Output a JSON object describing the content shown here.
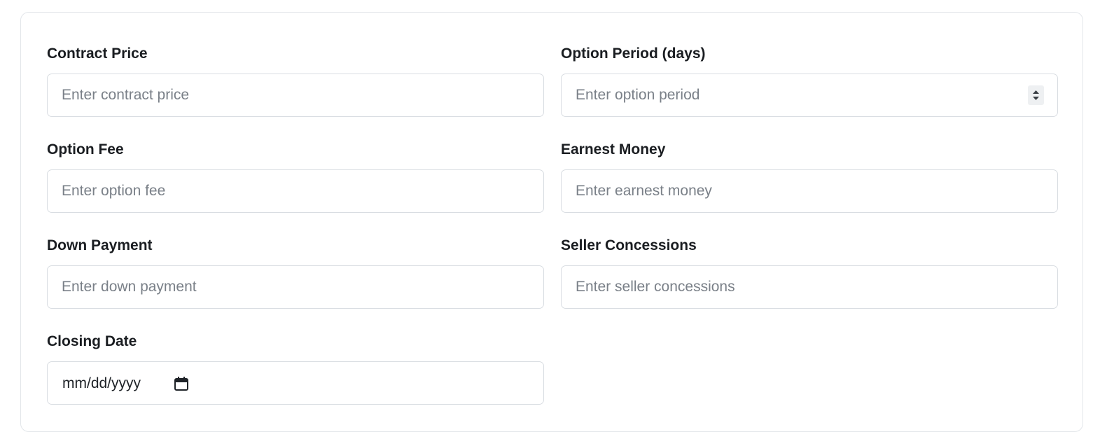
{
  "form": {
    "contract_price": {
      "label": "Contract Price",
      "placeholder": "Enter contract price"
    },
    "option_period": {
      "label": "Option Period (days)",
      "placeholder": "Enter option period"
    },
    "option_fee": {
      "label": "Option Fee",
      "placeholder": "Enter option fee"
    },
    "earnest_money": {
      "label": "Earnest Money",
      "placeholder": "Enter earnest money"
    },
    "down_payment": {
      "label": "Down Payment",
      "placeholder": "Enter down payment"
    },
    "seller_concessions": {
      "label": "Seller Concessions",
      "placeholder": "Enter seller concessions"
    },
    "closing_date": {
      "label": "Closing Date",
      "value_display": "mm/dd/yyyy"
    }
  },
  "icons": {
    "spinner": "spinner-arrows-icon",
    "calendar": "calendar-icon"
  },
  "colors": {
    "border": "#d9dde2",
    "label": "#1a1d21",
    "placeholder": "#7a8088"
  }
}
